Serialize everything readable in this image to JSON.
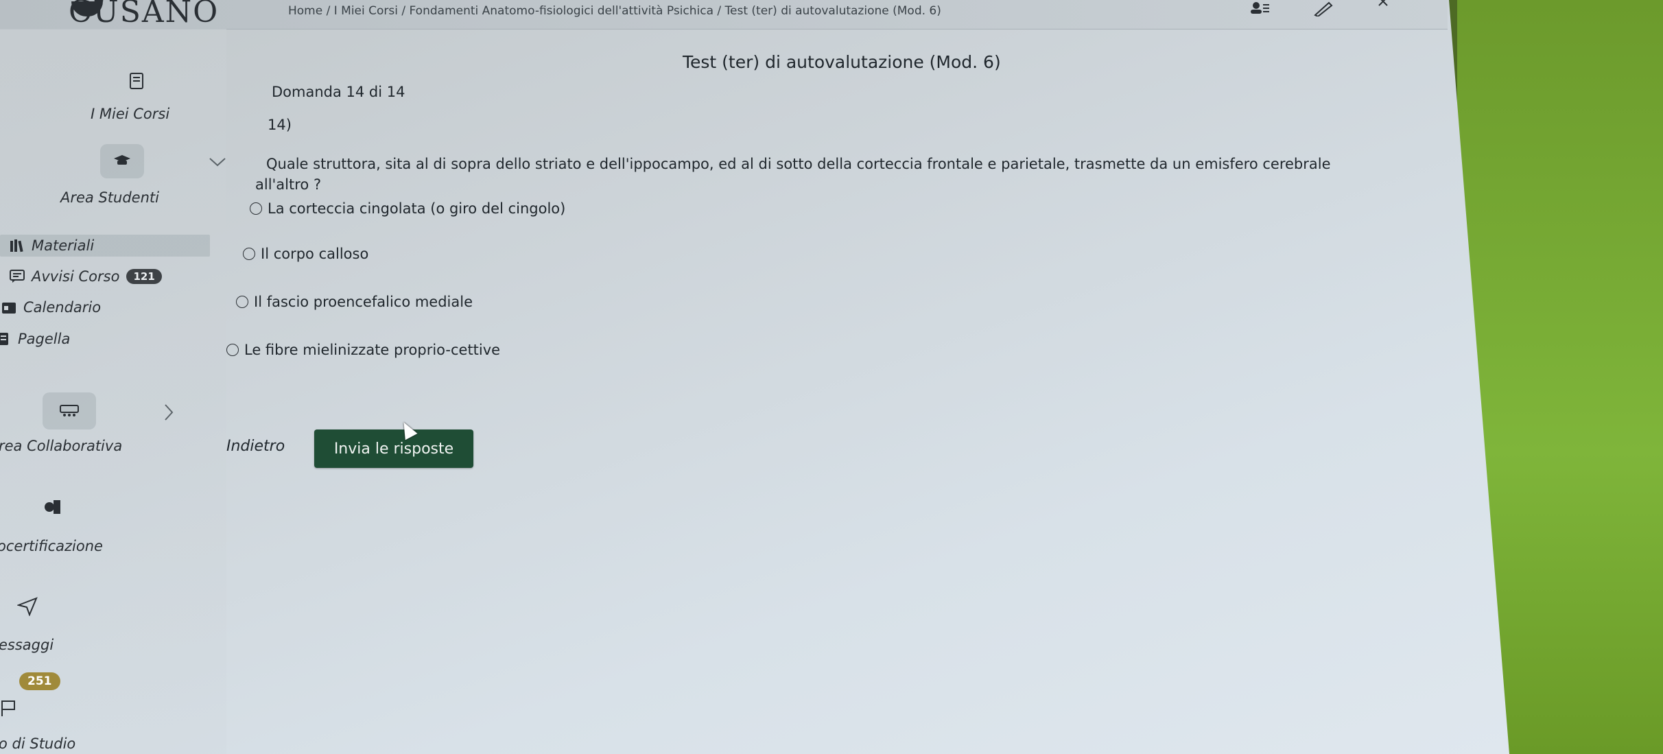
{
  "header": {
    "logo": "CUSANO",
    "breadcrumb": "Home / I Miei Corsi / Fondamenti Anatomo-fisiologici dell'attività Psichica / Test (ter) di autovalutazione (Mod. 6)"
  },
  "sidebar": {
    "my_courses": "I Miei Corsi",
    "student_area": "Area Studenti",
    "sub_items": [
      {
        "label": "Materiali",
        "icon": "books-icon",
        "active": true
      },
      {
        "label": "Avvisi Corso",
        "icon": "message-icon",
        "badge": "121"
      },
      {
        "label": "Calendario",
        "icon": "calendar-icon"
      },
      {
        "label": "Pagella",
        "icon": "report-card-icon"
      }
    ],
    "collaborative_area": "rea Collaborativa",
    "certification": "ocertificazione",
    "messages": "essaggi",
    "messages_badge": "251",
    "study": "o di Studio"
  },
  "quiz": {
    "title": "Test (ter) di autovalutazione (Mod. 6)",
    "counter": "Domanda 14 di 14",
    "number": "14)",
    "question_line1": "Quale struttora, sita al di sopra dello striato e dell'ippocampo, ed al di sotto della corteccia frontale e parietale, trasmette da un emisfero cerebrale",
    "question_line2": "all'altro ?",
    "options": [
      "La corteccia cingolata (o giro del cingolo)",
      "Il corpo calloso",
      "Il fascio proencefalico mediale",
      "Le fibre mielinizzate proprio-cettive"
    ],
    "back_label": "Indietro",
    "submit_label": "Invia le risposte"
  },
  "colors": {
    "submit_bg": "#1f4d35",
    "badge_dark": "#3e4246",
    "badge_gold": "#a08a3a"
  }
}
